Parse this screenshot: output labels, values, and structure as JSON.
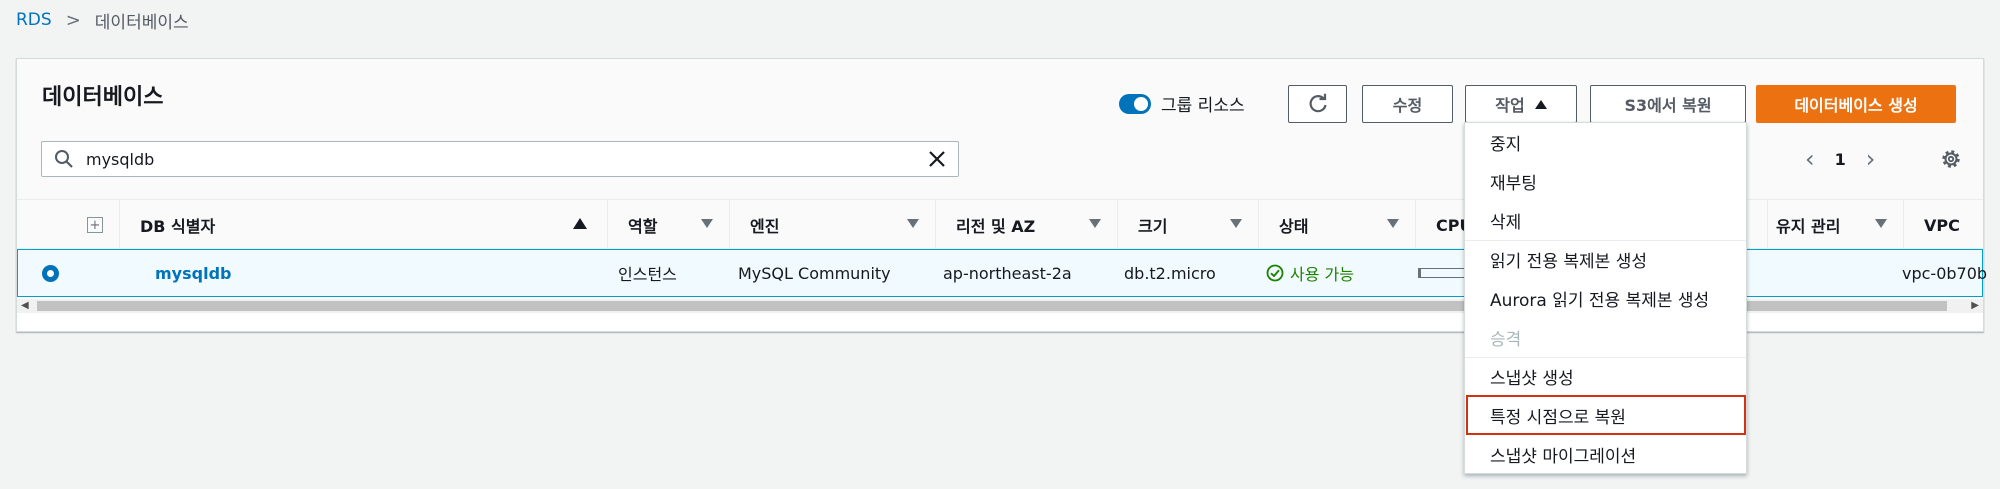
{
  "breadcrumb": {
    "root": "RDS",
    "separator": ">",
    "current": "데이터베이스"
  },
  "panel": {
    "title": "데이터베이스"
  },
  "toolbar": {
    "group_toggle_label": "그룹 리소스",
    "edit_label": "수정",
    "actions_label": "작업",
    "s3_restore_label": "S3에서 복원",
    "create_label": "데이터베이스 생성"
  },
  "search": {
    "value": "mysqldb",
    "placeholder": ""
  },
  "pagination": {
    "page": "1"
  },
  "table": {
    "columns": {
      "identifier": "DB 식별자",
      "role": "역할",
      "engine": "엔진",
      "region": "리전 및 AZ",
      "size": "크기",
      "status": "상태",
      "cpu": "CPU",
      "maintenance": "유지 관리",
      "vpc": "VPC"
    },
    "row": {
      "identifier": "mysqldb",
      "role": "인스턴스",
      "engine": "MySQL Community",
      "region": "ap-northeast-2a",
      "size": "db.t2.micro",
      "status": "사용 가능",
      "vpc": "vpc-0b70b"
    }
  },
  "actions_menu": {
    "items": [
      {
        "label": "중지",
        "disabled": false
      },
      {
        "label": "재부팅",
        "disabled": false
      },
      {
        "label": "삭제",
        "disabled": false
      },
      {
        "label": "읽기 전용 복제본 생성",
        "disabled": false
      },
      {
        "label": "Aurora 읽기 전용 복제본 생성",
        "disabled": false
      },
      {
        "label": "승격",
        "disabled": true
      },
      {
        "label": "스냅샷 생성",
        "disabled": false
      },
      {
        "label": "특정 시점으로 복원",
        "disabled": false,
        "highlighted": true
      },
      {
        "label": "스냅샷 마이그레이션",
        "disabled": false
      }
    ]
  },
  "colors": {
    "primary": "#ec7211",
    "link": "#0073bb",
    "success": "#1d8102",
    "highlight_border": "#d13212"
  }
}
